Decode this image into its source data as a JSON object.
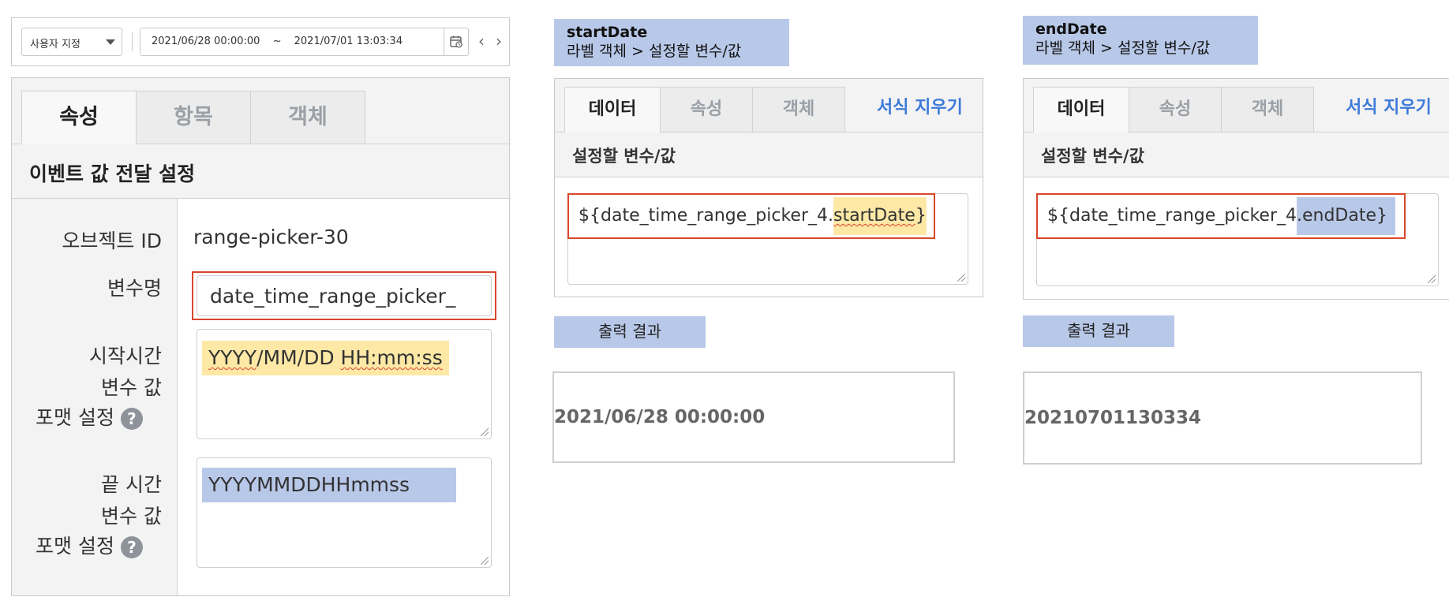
{
  "picker": {
    "preset_label": "사용자 지정",
    "start_value": "2021/06/28 00:00:00",
    "range_separator": "~",
    "end_value": "2021/07/01 13:03:34"
  },
  "left_panel": {
    "tabs": [
      {
        "label": "속성",
        "active": true
      },
      {
        "label": "항목",
        "active": false
      },
      {
        "label": "객체",
        "active": false
      }
    ],
    "section_title": "이벤트 값 전달 설정",
    "object_id_label": "오브젝트 ID",
    "object_id_value": "range-picker-30",
    "var_name_label": "변수명",
    "var_name_value": "date_time_range_picker_",
    "start_label_line1": "시작시간",
    "start_label_line2": "변수 값",
    "start_label_line3": "포맷 설정",
    "start_format_part1": "YYYY",
    "start_format_part2": "/MM/DD ",
    "start_format_part3": "HH:mm:ss",
    "end_label_line1": "끝 시간",
    "end_label_line2": "변수 값",
    "end_label_line3": "포맷 설정",
    "end_format": "YYYYMMDDHHmmss",
    "help_glyph": "?"
  },
  "start_panel": {
    "caption_title": "startDate",
    "caption_path": "라벨 객체 > 설정할 변수/값",
    "tabs": [
      {
        "label": "데이터",
        "active": true
      },
      {
        "label": "속성",
        "active": false
      },
      {
        "label": "객체",
        "active": false
      }
    ],
    "clear_label": "서식 지우기",
    "sub_label": "설정할 변수/값",
    "expr_prefix": "${date_time_range_picker_4",
    "expr_dot": ".",
    "expr_key": "startDate",
    "expr_suffix": "}",
    "output_caption": "출력 결과",
    "output_value": "2021/06/28 00:00:00"
  },
  "end_panel": {
    "caption_title": "endDate",
    "caption_path": "라벨 객체 > 설정할 변수/값",
    "tabs": [
      {
        "label": "데이터",
        "active": true
      },
      {
        "label": "속성",
        "active": false
      },
      {
        "label": "객체",
        "active": false
      }
    ],
    "clear_label": "서식 지우기",
    "sub_label": "설정할 변수/값",
    "expr_prefix": "${date_time_range_picker_4",
    "expr_key": ".endDate}",
    "output_caption": "출력 결과",
    "output_value": "20210701130334"
  },
  "colors": {
    "highlight_yellow": "#fde8a6",
    "highlight_blue": "#b8c8e8",
    "callout_red": "#d9472b",
    "link_blue": "#3d7ad9"
  },
  "icons": [
    "chevron-down-icon",
    "calendar-icon",
    "chevron-left-icon",
    "chevron-right-icon",
    "help-icon",
    "resize-grip-icon"
  ]
}
